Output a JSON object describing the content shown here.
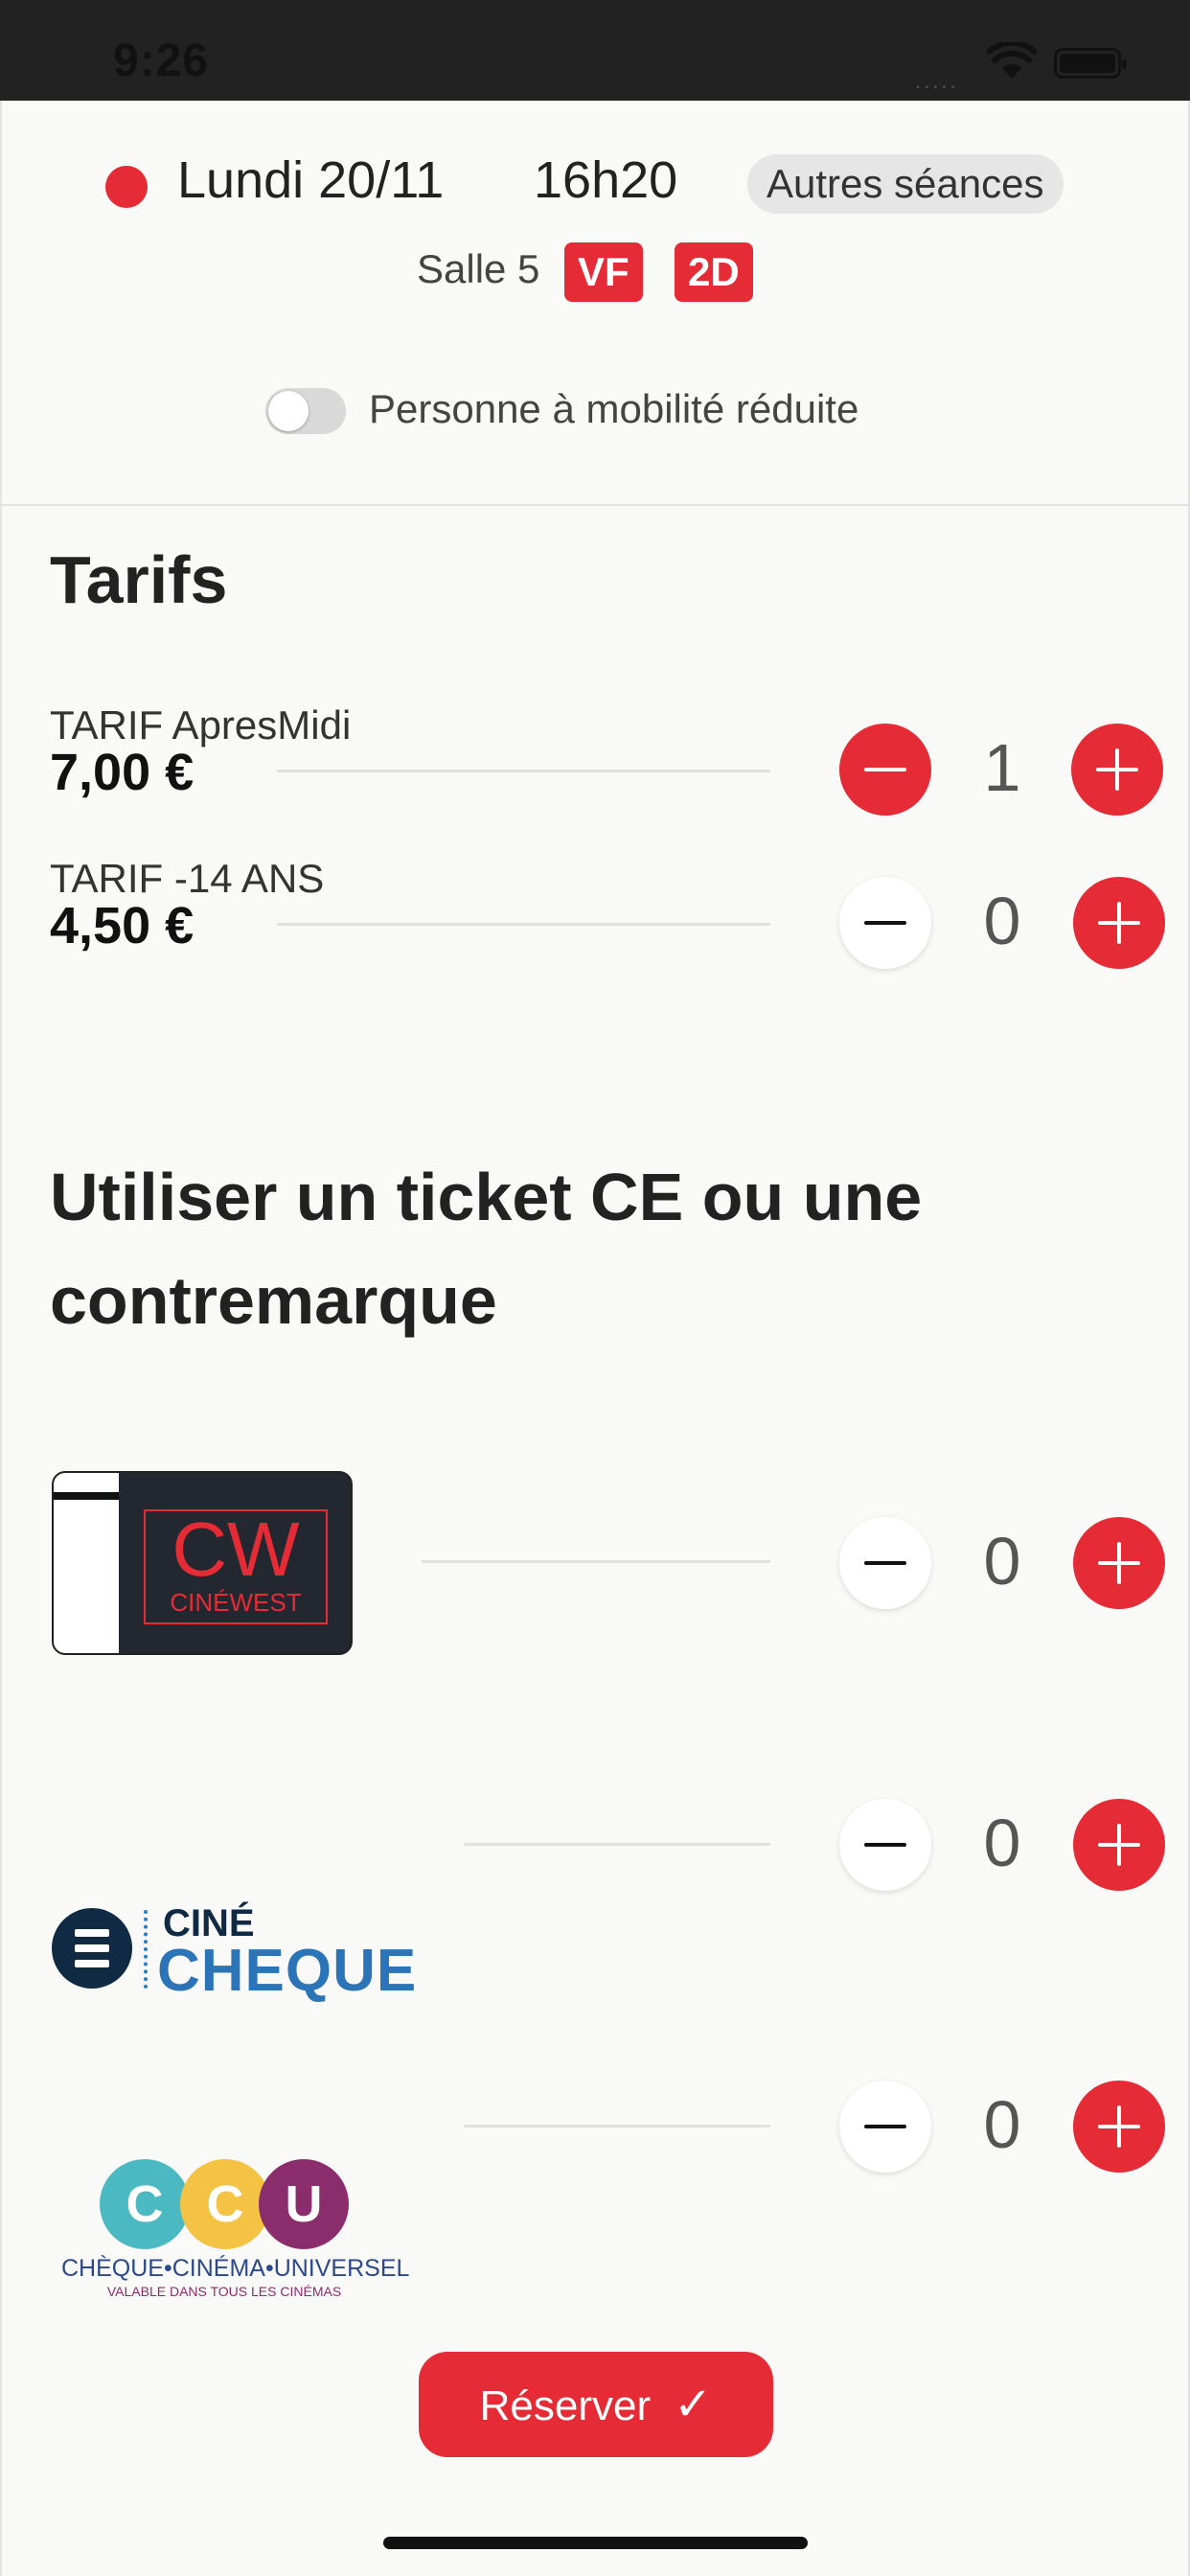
{
  "status_bar": {
    "time": "9:26",
    "signal": "....."
  },
  "session": {
    "date": "Lundi 20/11",
    "time": "16h20",
    "other_sessions_label": "Autres séances",
    "room": "Salle 5",
    "language_badge": "VF",
    "format_badge": "2D",
    "pmr_label": "Personne à mobilité réduite",
    "pmr_enabled": false
  },
  "tarifs": {
    "title": "Tarifs",
    "items": [
      {
        "name": "TARIF ApresMidi",
        "price": "7,00 €",
        "quantity": "1"
      },
      {
        "name": "TARIF -14 ANS",
        "price": "4,50 €",
        "quantity": "0"
      }
    ]
  },
  "vouchers": {
    "title": "Utiliser un ticket CE ou une contremarque",
    "items": [
      {
        "logo": "cinewest-logo",
        "logo_text": "CW",
        "logo_name": "CINÉWEST",
        "quantity": "0"
      },
      {
        "logo": "cine-cheque-logo",
        "logo_text_top": "CINÉ",
        "logo_text_bottom": "CHEQUE",
        "quantity": "0"
      },
      {
        "logo": "cheque-cinema-universel-logo",
        "logo_letters": [
          "C",
          "C",
          "U"
        ],
        "logo_line1": "CHÈQUE•CINÉMA•UNIVERSEL",
        "logo_line2": "VALABLE DANS TOUS LES CINÉMAS",
        "quantity": "0"
      }
    ]
  },
  "footer": {
    "reserve_label": "Réserver",
    "reserve_icon": "check-icon"
  },
  "colors": {
    "accent": "#e52b35",
    "background": "#f9f9f7"
  }
}
